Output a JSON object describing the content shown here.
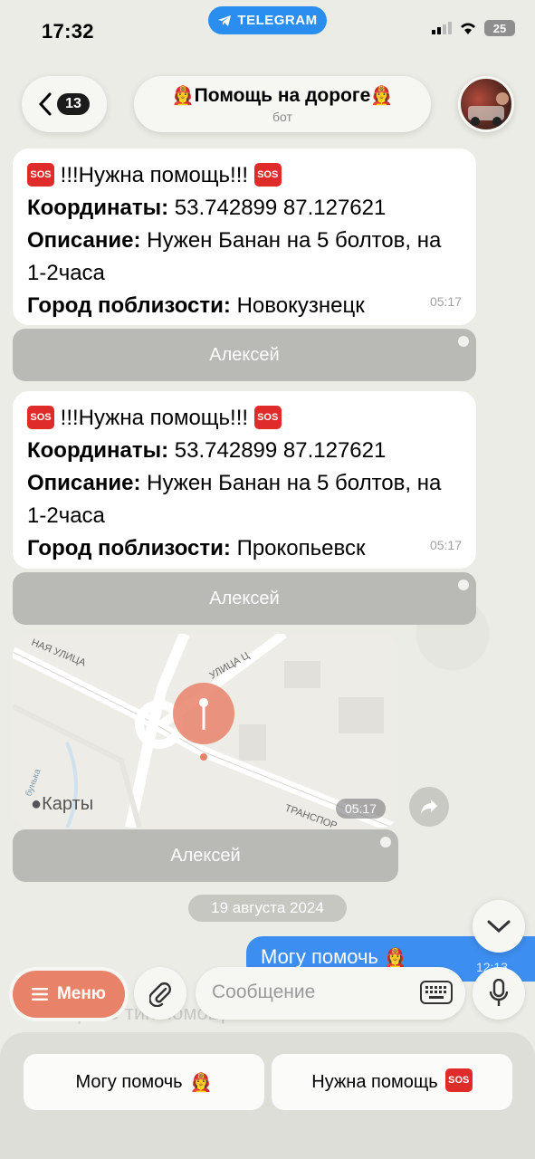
{
  "status": {
    "time": "17:32",
    "app_pill": "TELEGRAM",
    "battery": "25"
  },
  "header": {
    "back_count": "13",
    "title": "Помощь на дороге",
    "title_emoji": "👩‍🚒",
    "subtitle": "бот"
  },
  "messages": [
    {
      "header": "!!!Нужна помощь!!!",
      "coords_label": "Координаты:",
      "coords_value": "53.742899 87.127621",
      "desc_label": "Описание:",
      "desc_value": "Нужен Банан на 5 болтов, на 1-2часа",
      "city_label": "Город поблизости:",
      "city_value": "Новокузнецк",
      "time": "05:17",
      "button": "Алексей"
    },
    {
      "header": "!!!Нужна помощь!!!",
      "coords_label": "Координаты:",
      "coords_value": "53.742899 87.127621",
      "desc_label": "Описание:",
      "desc_value": "Нужен Банан на 5 болтов, на 1-2часа",
      "city_label": "Город поблизости:",
      "city_value": "Прокопьевск",
      "time": "05:17",
      "button": "Алексей"
    }
  ],
  "sos_badge": "SOS",
  "map": {
    "brand": "Карты",
    "street_1": "НАЯ УЛИЦА",
    "street_2": "УЛИЦА Ц",
    "street_3": "ТРАНСПОР",
    "street_4": "бунька",
    "time": "05:17",
    "button": "Алексей"
  },
  "date_separator": "19 августа 2024",
  "outgoing": {
    "text": "Могу помочь",
    "time": "12:13"
  },
  "faded_text": "Выберите тип помощи",
  "input": {
    "menu_label": "Меню",
    "placeholder": "Сообщение"
  },
  "keyboard": {
    "btn_help": "Могу помочь",
    "btn_need": "Нужна помощь"
  },
  "colors": {
    "accent_blue": "#3d8ef1",
    "menu_orange": "#e8836a",
    "sos_red": "#e02b2b"
  }
}
